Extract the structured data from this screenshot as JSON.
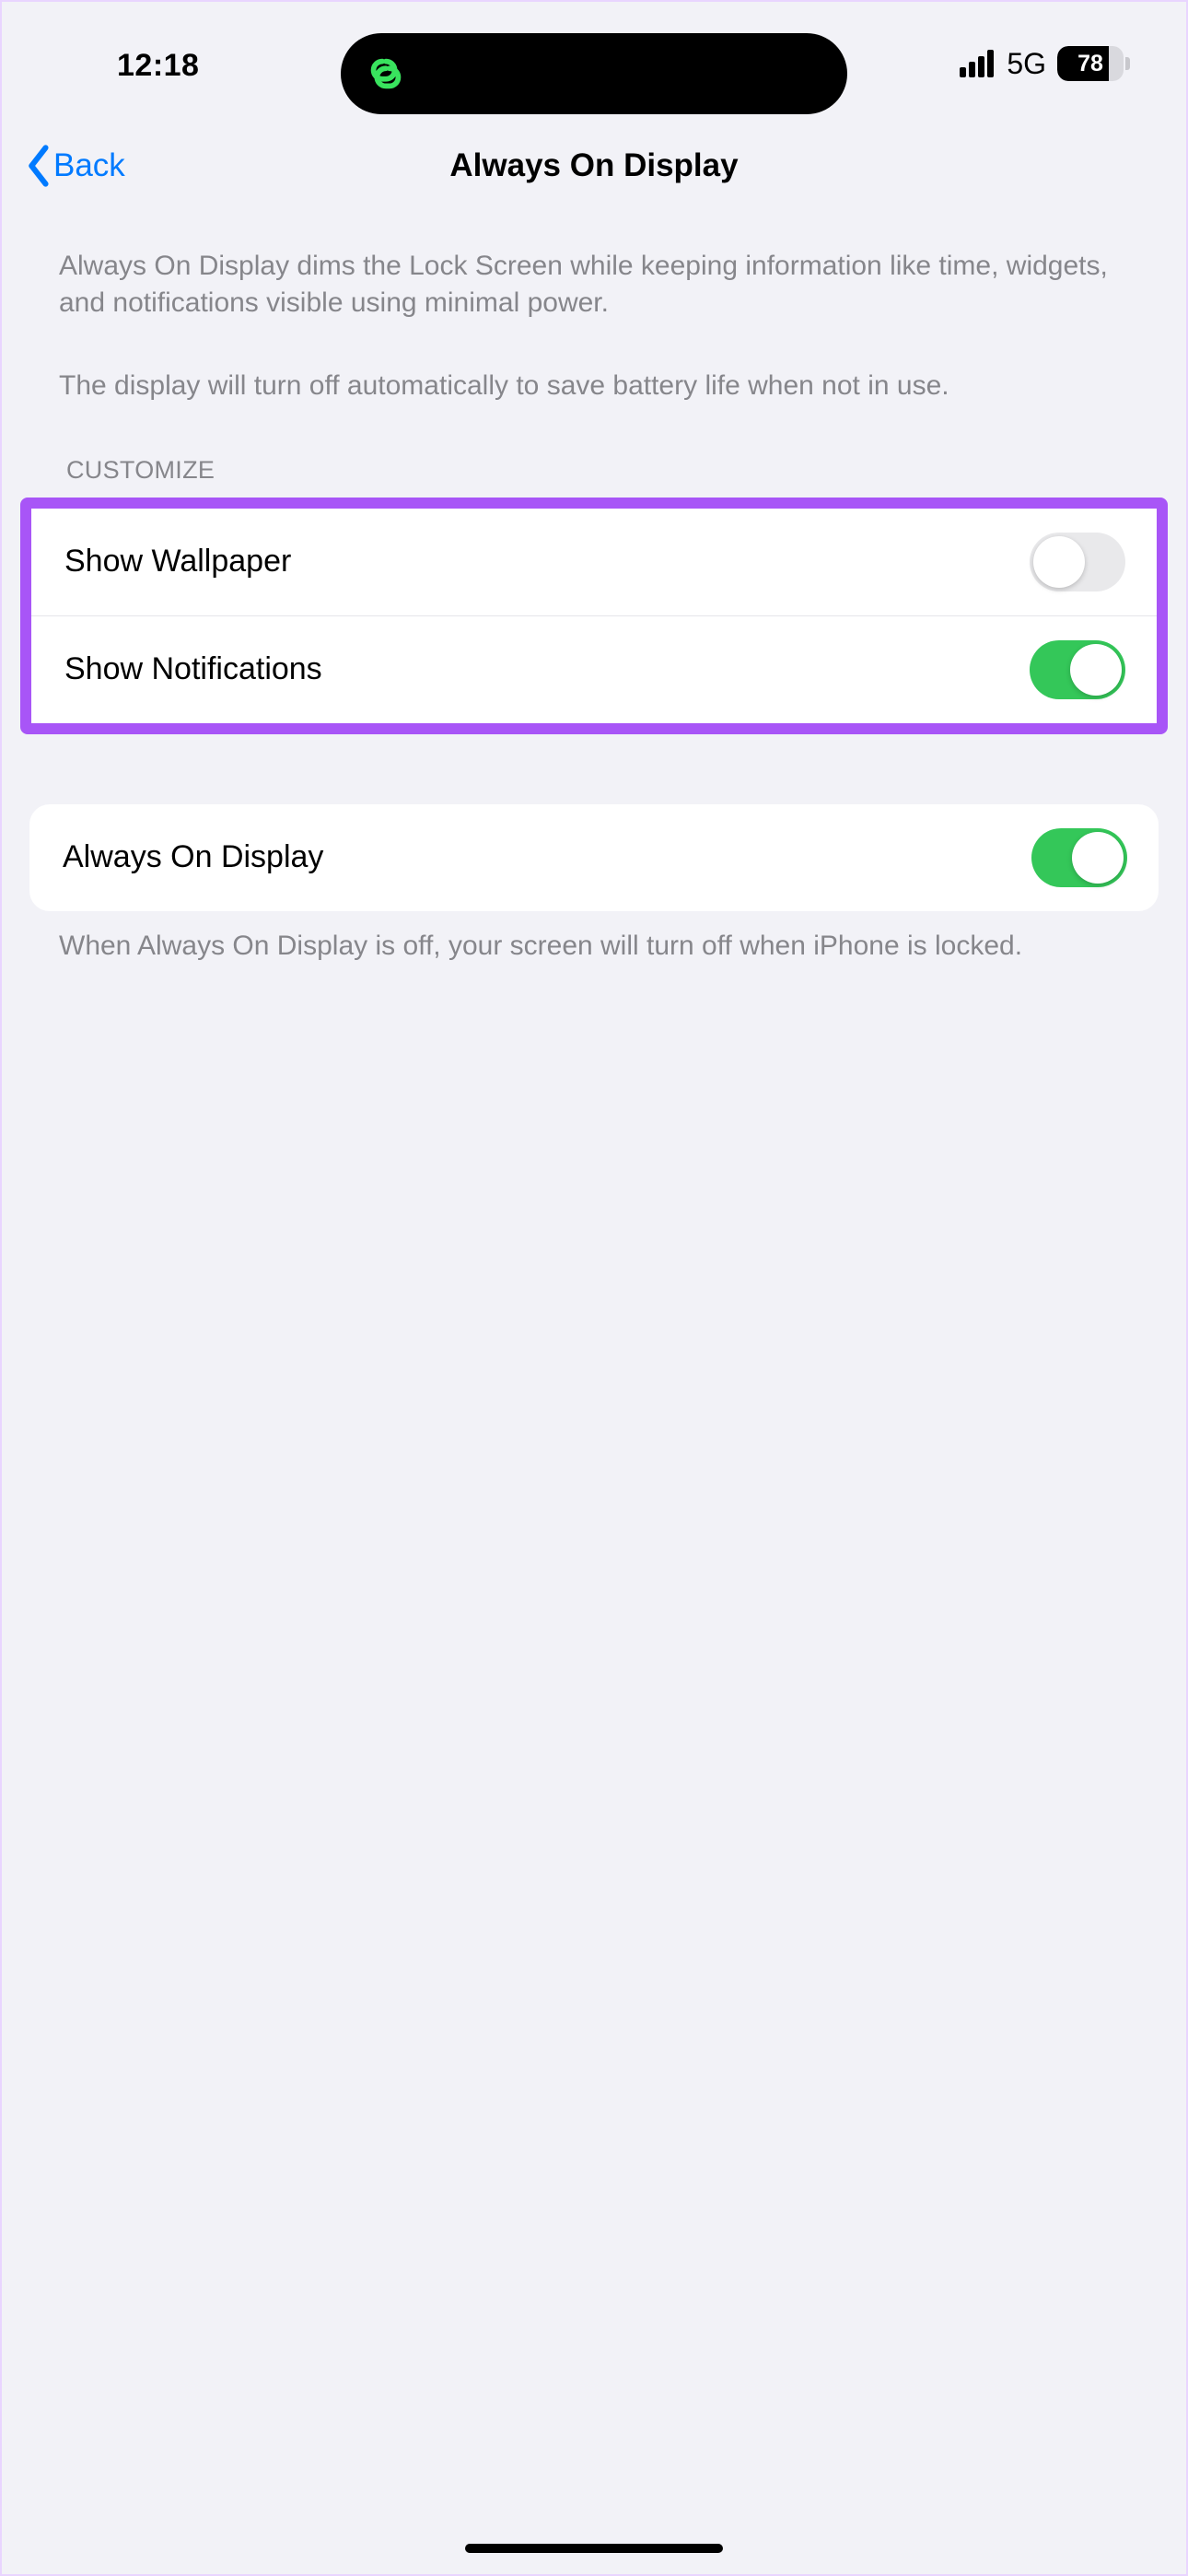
{
  "status": {
    "time": "12:18",
    "network": "5G",
    "battery_pct": "78"
  },
  "nav": {
    "back_label": "Back",
    "title": "Always On Display"
  },
  "description": {
    "para1": "Always On Display dims the Lock Screen while keeping information like time, widgets, and notifications visible using minimal power.",
    "para2": "The display will turn off automatically to save battery life when not in use."
  },
  "sections": {
    "customize_header": "CUSTOMIZE"
  },
  "rows": {
    "show_wallpaper": {
      "label": "Show Wallpaper",
      "on": false
    },
    "show_notifications": {
      "label": "Show Notifications",
      "on": true
    },
    "always_on": {
      "label": "Always On Display",
      "on": true
    }
  },
  "footer": "When Always On Display is off, your screen will turn off when iPhone is locked."
}
